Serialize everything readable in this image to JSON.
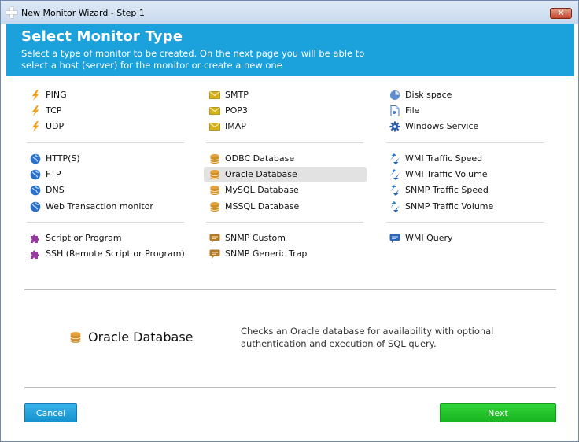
{
  "window": {
    "title": "New Monitor Wizard - Step 1",
    "close_glyph": "✕"
  },
  "header": {
    "title": "Select Monitor Type",
    "subtitle": "Select a type of monitor to be created. On the next page you will be able to select a host (server) for the monitor or create a new one"
  },
  "columns": [
    {
      "groups": [
        [
          {
            "label": "PING",
            "icon": "bolt-icon"
          },
          {
            "label": "TCP",
            "icon": "bolt-icon"
          },
          {
            "label": "UDP",
            "icon": "bolt-icon"
          }
        ],
        [
          {
            "label": "HTTP(S)",
            "icon": "globe-icon"
          },
          {
            "label": "FTP",
            "icon": "globe-icon"
          },
          {
            "label": "DNS",
            "icon": "globe-icon"
          },
          {
            "label": "Web Transaction monitor",
            "icon": "globe-icon"
          }
        ],
        [
          {
            "label": "Script or Program",
            "icon": "puzzle-icon"
          },
          {
            "label": "SSH (Remote Script or Program)",
            "icon": "puzzle-icon"
          }
        ]
      ]
    },
    {
      "groups": [
        [
          {
            "label": "SMTP",
            "icon": "mail-icon"
          },
          {
            "label": "POP3",
            "icon": "mail-icon"
          },
          {
            "label": "IMAP",
            "icon": "mail-icon"
          }
        ],
        [
          {
            "label": "ODBC Database",
            "icon": "database-icon"
          },
          {
            "label": "Oracle Database",
            "icon": "database-icon",
            "selected": true
          },
          {
            "label": "MySQL Database",
            "icon": "database-icon"
          },
          {
            "label": "MSSQL Database",
            "icon": "database-icon"
          }
        ],
        [
          {
            "label": "SNMP Custom",
            "icon": "chat-icon"
          },
          {
            "label": "SNMP Generic Trap",
            "icon": "chat-icon"
          }
        ]
      ]
    },
    {
      "groups": [
        [
          {
            "label": "Disk space",
            "icon": "pie-icon"
          },
          {
            "label": "File",
            "icon": "file-icon"
          },
          {
            "label": "Windows Service",
            "icon": "gear-icon"
          }
        ],
        [
          {
            "label": "WMI Traffic Speed",
            "icon": "traffic-icon"
          },
          {
            "label": "WMI Traffic Volume",
            "icon": "traffic-icon"
          },
          {
            "label": "SNMP Traffic Speed",
            "icon": "traffic-icon"
          },
          {
            "label": "SNMP Traffic Volume",
            "icon": "traffic-icon"
          }
        ],
        [
          {
            "label": "WMI Query",
            "icon": "wmi-chat-icon"
          }
        ]
      ]
    }
  ],
  "detail": {
    "name": "Oracle Database",
    "icon": "database-icon",
    "description": "Checks an Oracle database for availability with optional authentication and execution of SQL query."
  },
  "buttons": {
    "cancel": "Cancel",
    "next": "Next"
  },
  "colors": {
    "header_bg": "#1ba1dc",
    "bolt": "#f0a21e",
    "mail": "#d4b21a",
    "globe": "#2a6fc9",
    "database": "#e3a23b",
    "puzzle": "#9a3aa0",
    "chat": "#b07b2a",
    "traffic": "#2f7fd0",
    "cancel_bg": "#1a9ad6",
    "next_bg": "#1fbf27",
    "selected_bg": "#e2e2e2"
  }
}
